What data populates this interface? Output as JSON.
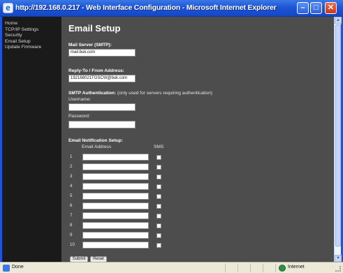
{
  "window": {
    "title": "http://192.168.0.217 - Web Interface Configuration - Microsoft Internet Explorer",
    "buttons": {
      "minimize": "–",
      "maximize": "□",
      "close": "✕"
    }
  },
  "sidebar": {
    "items": [
      {
        "label": "Home"
      },
      {
        "label": "TCP/IP Settings"
      },
      {
        "label": "Security"
      },
      {
        "label": "Email Setup"
      },
      {
        "label": "Update Firmware"
      }
    ]
  },
  "main": {
    "title": "Email Setup",
    "mail_server": {
      "label": "Mail Server (SMTP):",
      "value": "mail.buk.com"
    },
    "reply_to": {
      "label": "Reply-To / From Address:",
      "value": "192168021TGSCW@buk.com"
    },
    "smtp_auth": {
      "label": "SMTP Authentication:",
      "note": "(only used for servers requiring authentication)",
      "username_label": "Username:",
      "username_value": "",
      "password_label": "Password:",
      "password_value": ""
    },
    "notification": {
      "label": "Email Notification Setup:",
      "col_email": "Email Address",
      "col_sms": "SMS",
      "rows": [
        {
          "num": "1"
        },
        {
          "num": "2"
        },
        {
          "num": "3"
        },
        {
          "num": "4"
        },
        {
          "num": "5"
        },
        {
          "num": "6"
        },
        {
          "num": "7"
        },
        {
          "num": "8"
        },
        {
          "num": "9"
        },
        {
          "num": "10"
        }
      ]
    },
    "buttons": {
      "submit": "Submit",
      "reset": "Reset"
    }
  },
  "statusbar": {
    "status": "Done",
    "zone": "Internet"
  },
  "icons": {
    "app": "ie-icon",
    "status": "page-done-icon",
    "zone": "internet-globe-icon"
  }
}
